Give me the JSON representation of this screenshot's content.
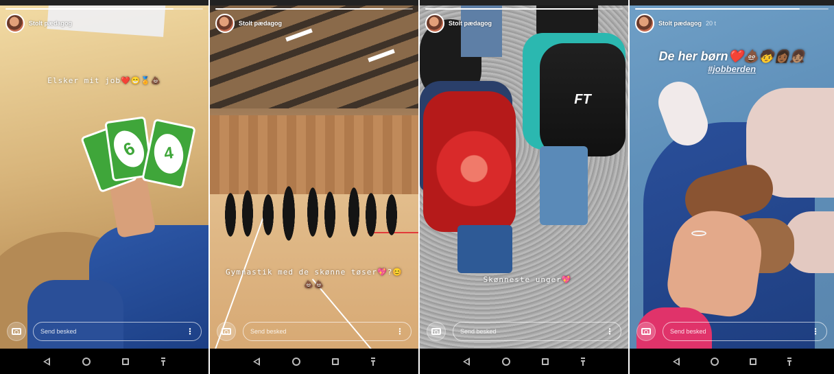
{
  "stories": [
    {
      "username": "Stolt pædagog",
      "timestamp": "",
      "caption": "Elsker mit job❤️😁🏅💩",
      "hashtag": "",
      "message_placeholder": "Send besked",
      "progress": 0.85
    },
    {
      "username": "Stolt pædagog",
      "timestamp": "",
      "caption": "Gymnastik med de skønne tøser💖?😊💩💩",
      "hashtag": "",
      "message_placeholder": "Send besked",
      "progress": 0.85
    },
    {
      "username": "Stolt pædagog",
      "timestamp": "",
      "caption": "Skønneste unger💖",
      "hashtag": "",
      "message_placeholder": "Send besked",
      "progress": 0.85
    },
    {
      "username": "Stolt pædagog",
      "timestamp": "20 t",
      "caption": "De her børn❤️💩🧒👩🏾👧🏽",
      "hashtag": "#jobberden",
      "message_placeholder": "Send besked",
      "progress": 0.85
    }
  ],
  "backpack_text": "FT",
  "uno_card_numbers": [
    "6",
    "4"
  ],
  "icons": {
    "camera": "camera-icon",
    "more": "kebab-menu-icon",
    "back": "nav-back-icon",
    "home": "nav-home-icon",
    "recent": "nav-recent-icon",
    "extra": "nav-notification-icon"
  },
  "colors": {
    "uno_green": "#3fa63a",
    "heart": "#e0245e",
    "navbar": "#000000"
  }
}
